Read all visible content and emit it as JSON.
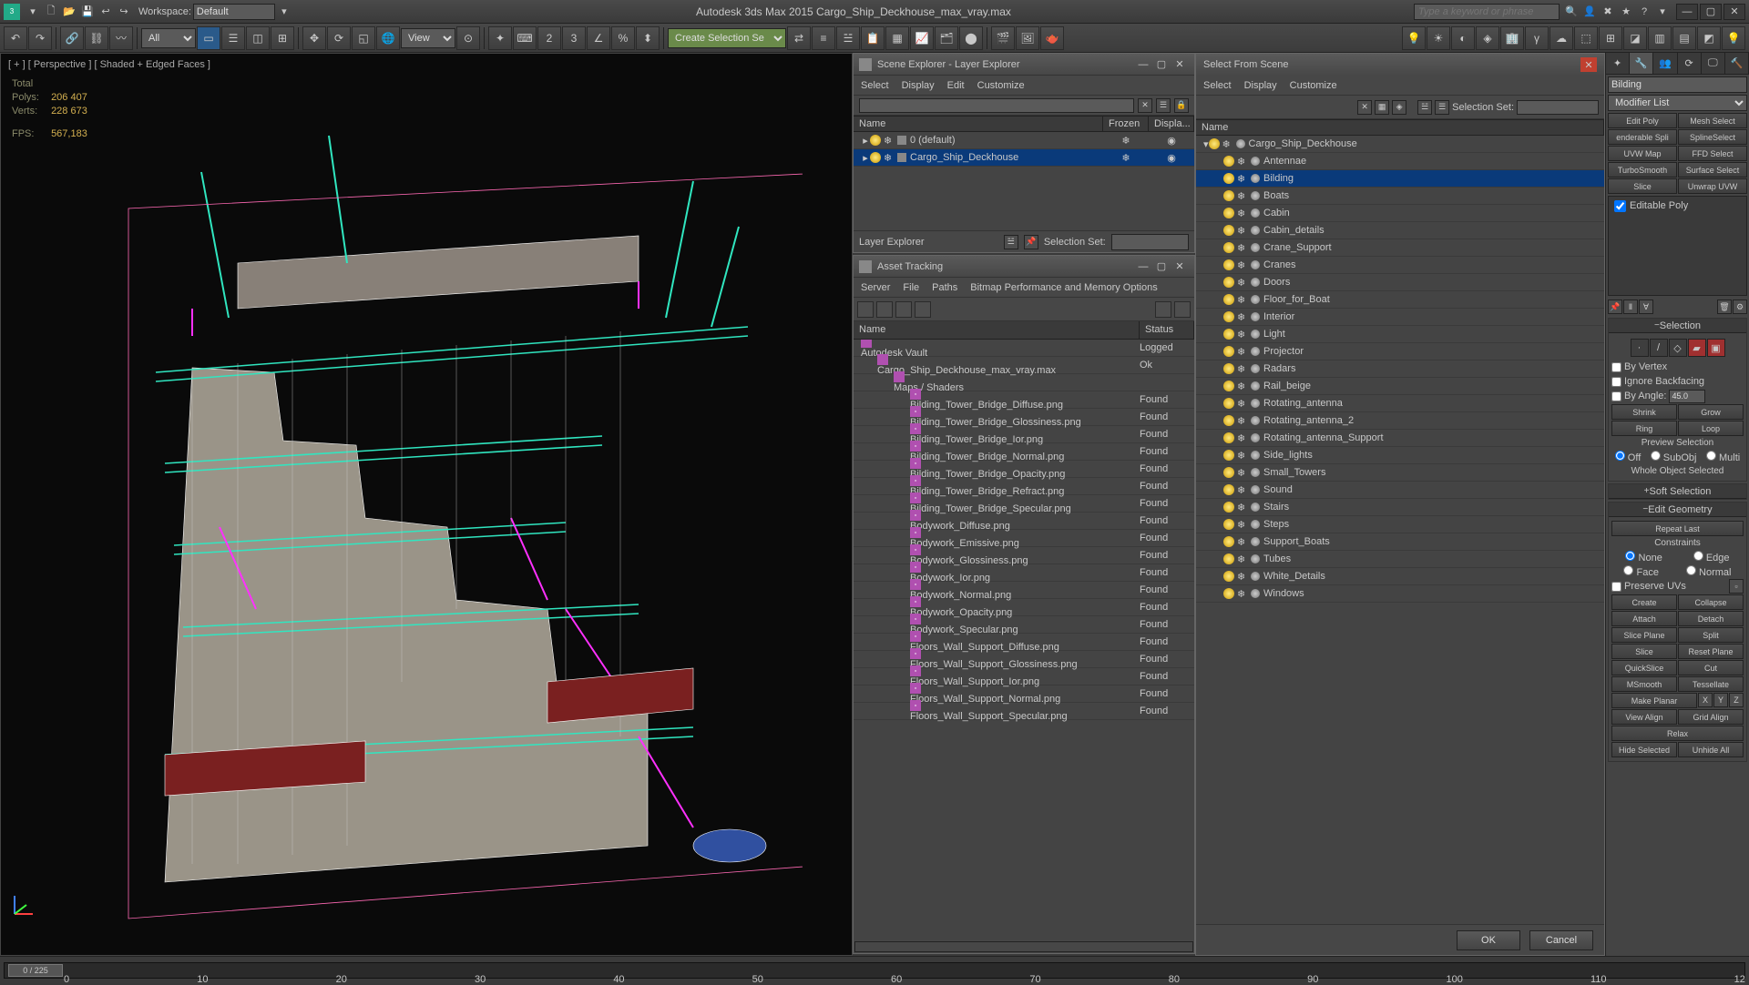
{
  "app": {
    "title": "Autodesk 3ds Max 2015    Cargo_Ship_Deckhouse_max_vray.max",
    "workspace_label": "Workspace:",
    "workspace_value": "Default",
    "search_placeholder": "Type a keyword or phrase"
  },
  "toolbar": {
    "filter": "All",
    "create_set": "Create Selection Se"
  },
  "viewport": {
    "label": "[ + ] [ Perspective ] [ Shaded + Edged Faces ]",
    "stats": {
      "total": "Total",
      "polys_lbl": "Polys:",
      "polys": "206 407",
      "verts_lbl": "Verts:",
      "verts": "228 673",
      "fps_lbl": "FPS:",
      "fps": "567,183"
    }
  },
  "scene_explorer": {
    "title": "Scene Explorer - Layer Explorer",
    "menu": [
      "Select",
      "Display",
      "Edit",
      "Customize"
    ],
    "cols": [
      "Name",
      "Frozen",
      "Displa..."
    ],
    "rows": [
      {
        "name": "0 (default)",
        "selected": false
      },
      {
        "name": "Cargo_Ship_Deckhouse",
        "selected": true
      }
    ],
    "footer_label": "Layer Explorer",
    "selection_set": "Selection Set:"
  },
  "asset_tracking": {
    "title": "Asset Tracking",
    "menu": [
      "Server",
      "File",
      "Paths",
      "Bitmap Performance and Memory Options"
    ],
    "cols": [
      "Name",
      "Status"
    ],
    "rows": [
      {
        "indent": 0,
        "icon": "vault",
        "name": "Autodesk Vault",
        "status": "Logged"
      },
      {
        "indent": 1,
        "icon": "max",
        "name": "Cargo_Ship_Deckhouse_max_vray.max",
        "status": "Ok"
      },
      {
        "indent": 2,
        "icon": "folder",
        "name": "Maps / Shaders",
        "status": ""
      },
      {
        "indent": 3,
        "icon": "img",
        "name": "Bilding_Tower_Bridge_Diffuse.png",
        "status": "Found"
      },
      {
        "indent": 3,
        "icon": "img",
        "name": "Bilding_Tower_Bridge_Glossiness.png",
        "status": "Found"
      },
      {
        "indent": 3,
        "icon": "img",
        "name": "Bilding_Tower_Bridge_Ior.png",
        "status": "Found"
      },
      {
        "indent": 3,
        "icon": "img",
        "name": "Bilding_Tower_Bridge_Normal.png",
        "status": "Found"
      },
      {
        "indent": 3,
        "icon": "img",
        "name": "Bilding_Tower_Bridge_Opacity.png",
        "status": "Found"
      },
      {
        "indent": 3,
        "icon": "img",
        "name": "Bilding_Tower_Bridge_Refract.png",
        "status": "Found"
      },
      {
        "indent": 3,
        "icon": "img",
        "name": "Bilding_Tower_Bridge_Specular.png",
        "status": "Found"
      },
      {
        "indent": 3,
        "icon": "img",
        "name": "Bodywork_Diffuse.png",
        "status": "Found"
      },
      {
        "indent": 3,
        "icon": "img",
        "name": "Bodywork_Emissive.png",
        "status": "Found"
      },
      {
        "indent": 3,
        "icon": "img",
        "name": "Bodywork_Glossiness.png",
        "status": "Found"
      },
      {
        "indent": 3,
        "icon": "img",
        "name": "Bodywork_Ior.png",
        "status": "Found"
      },
      {
        "indent": 3,
        "icon": "img",
        "name": "Bodywork_Normal.png",
        "status": "Found"
      },
      {
        "indent": 3,
        "icon": "img",
        "name": "Bodywork_Opacity.png",
        "status": "Found"
      },
      {
        "indent": 3,
        "icon": "img",
        "name": "Bodywork_Specular.png",
        "status": "Found"
      },
      {
        "indent": 3,
        "icon": "img",
        "name": "Floors_Wall_Support_Diffuse.png",
        "status": "Found"
      },
      {
        "indent": 3,
        "icon": "img",
        "name": "Floors_Wall_Support_Glossiness.png",
        "status": "Found"
      },
      {
        "indent": 3,
        "icon": "img",
        "name": "Floors_Wall_Support_Ior.png",
        "status": "Found"
      },
      {
        "indent": 3,
        "icon": "img",
        "name": "Floors_Wall_Support_Normal.png",
        "status": "Found"
      },
      {
        "indent": 3,
        "icon": "img",
        "name": "Floors_Wall_Support_Specular.png",
        "status": "Found"
      }
    ]
  },
  "select_from_scene": {
    "title": "Select From Scene",
    "menu": [
      "Select",
      "Display",
      "Customize"
    ],
    "selection_set": "Selection Set:",
    "cols": [
      "Name"
    ],
    "root": "Cargo_Ship_Deckhouse",
    "items": [
      "Antennae",
      "Bilding",
      "Boats",
      "Cabin",
      "Cabin_details",
      "Crane_Support",
      "Cranes",
      "Doors",
      "Floor_for_Boat",
      "Interior",
      "Light",
      "Projector",
      "Radars",
      "Rail_beige",
      "Rotating_antenna",
      "Rotating_antenna_2",
      "Rotating_antenna_Support",
      "Side_lights",
      "Small_Towers",
      "Sound",
      "Stairs",
      "Steps",
      "Support_Boats",
      "Tubes",
      "White_Details",
      "Windows"
    ],
    "selected": "Bilding",
    "ok": "OK",
    "cancel": "Cancel"
  },
  "cmd": {
    "object_name": "Bilding",
    "modifier_list": "Modifier List",
    "mod_buttons": [
      "Edit Poly",
      "Mesh Select",
      "enderable Spli",
      "SplineSelect",
      "UVW Map",
      "FFD Select",
      "TurboSmooth",
      "Surface Select",
      "Slice",
      "Unwrap UVW"
    ],
    "stack": [
      "Editable Poly"
    ],
    "selection": {
      "title": "Selection",
      "by_vertex": "By Vertex",
      "ignore_backfacing": "Ignore Backfacing",
      "by_angle": "By Angle:",
      "angle": "45.0",
      "shrink": "Shrink",
      "grow": "Grow",
      "ring": "Ring",
      "loop": "Loop",
      "preview": "Preview Selection",
      "off": "Off",
      "subobj": "SubObj",
      "multi": "Multi",
      "whole": "Whole Object Selected"
    },
    "soft_selection": "Soft Selection",
    "edit_geometry": {
      "title": "Edit Geometry",
      "repeat": "Repeat Last",
      "constraints": "Constraints",
      "none": "None",
      "edge": "Edge",
      "face": "Face",
      "normal": "Normal",
      "preserve_uvs": "Preserve UVs",
      "create": "Create",
      "collapse": "Collapse",
      "attach": "Attach",
      "detach": "Detach",
      "slice_plane": "Slice Plane",
      "split": "Split",
      "slice": "Slice",
      "reset_plane": "Reset Plane",
      "quickslice": "QuickSlice",
      "cut": "Cut",
      "msmooth": "MSmooth",
      "tessellate": "Tessellate",
      "make_planar": "Make Planar",
      "x": "X",
      "y": "Y",
      "z": "Z",
      "view_align": "View Align",
      "grid_align": "Grid Align",
      "relax": "Relax",
      "hide_selected": "Hide Selected",
      "unhide_all": "Unhide All"
    }
  },
  "timeline": {
    "frame": "0 / 225",
    "ticks": [
      "0",
      "10",
      "20",
      "30",
      "40",
      "50",
      "60",
      "70",
      "80",
      "90",
      "100",
      "110",
      "12"
    ]
  }
}
